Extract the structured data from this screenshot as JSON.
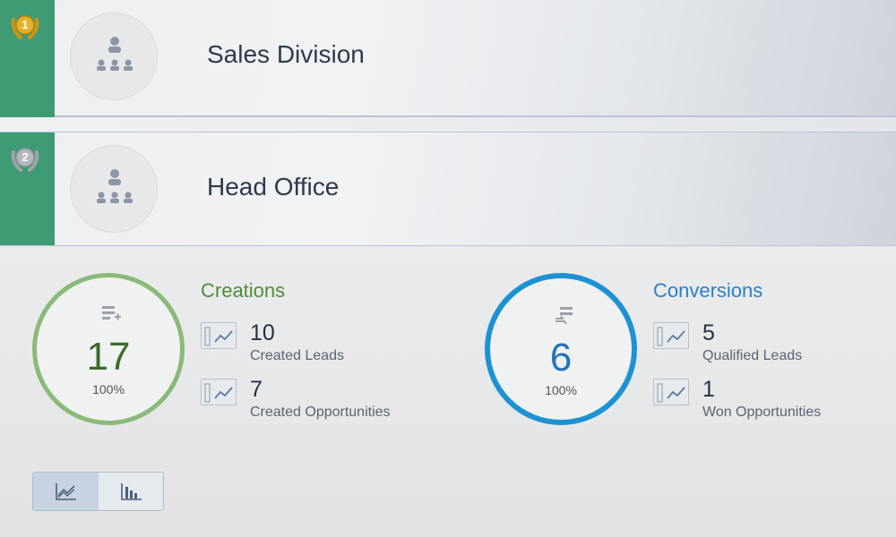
{
  "rows": [
    {
      "rank": "1",
      "name": "Sales Division",
      "badge_color": "#d9a81e"
    },
    {
      "rank": "2",
      "name": "Head Office",
      "badge_color": "#a9aeb4"
    }
  ],
  "creations": {
    "title": "Creations",
    "total": "17",
    "percent": "100%",
    "metrics": [
      {
        "value": "10",
        "label": "Created Leads"
      },
      {
        "value": "7",
        "label": "Created Opportunities"
      }
    ],
    "color": "#8ab97a"
  },
  "conversions": {
    "title": "Conversions",
    "total": "6",
    "percent": "100%",
    "metrics": [
      {
        "value": "5",
        "label": "Qualified Leads"
      },
      {
        "value": "1",
        "label": "Won Opportunities"
      }
    ],
    "color": "#1d92d3"
  },
  "icons": {
    "badge": "laurel-badge-icon",
    "avatar": "org-chart-icon",
    "creations": "list-add-icon",
    "conversions": "list-convert-icon",
    "metric": "trend-chart-icon",
    "view_line": "line-chart-icon",
    "view_bar": "bar-chart-icon"
  }
}
